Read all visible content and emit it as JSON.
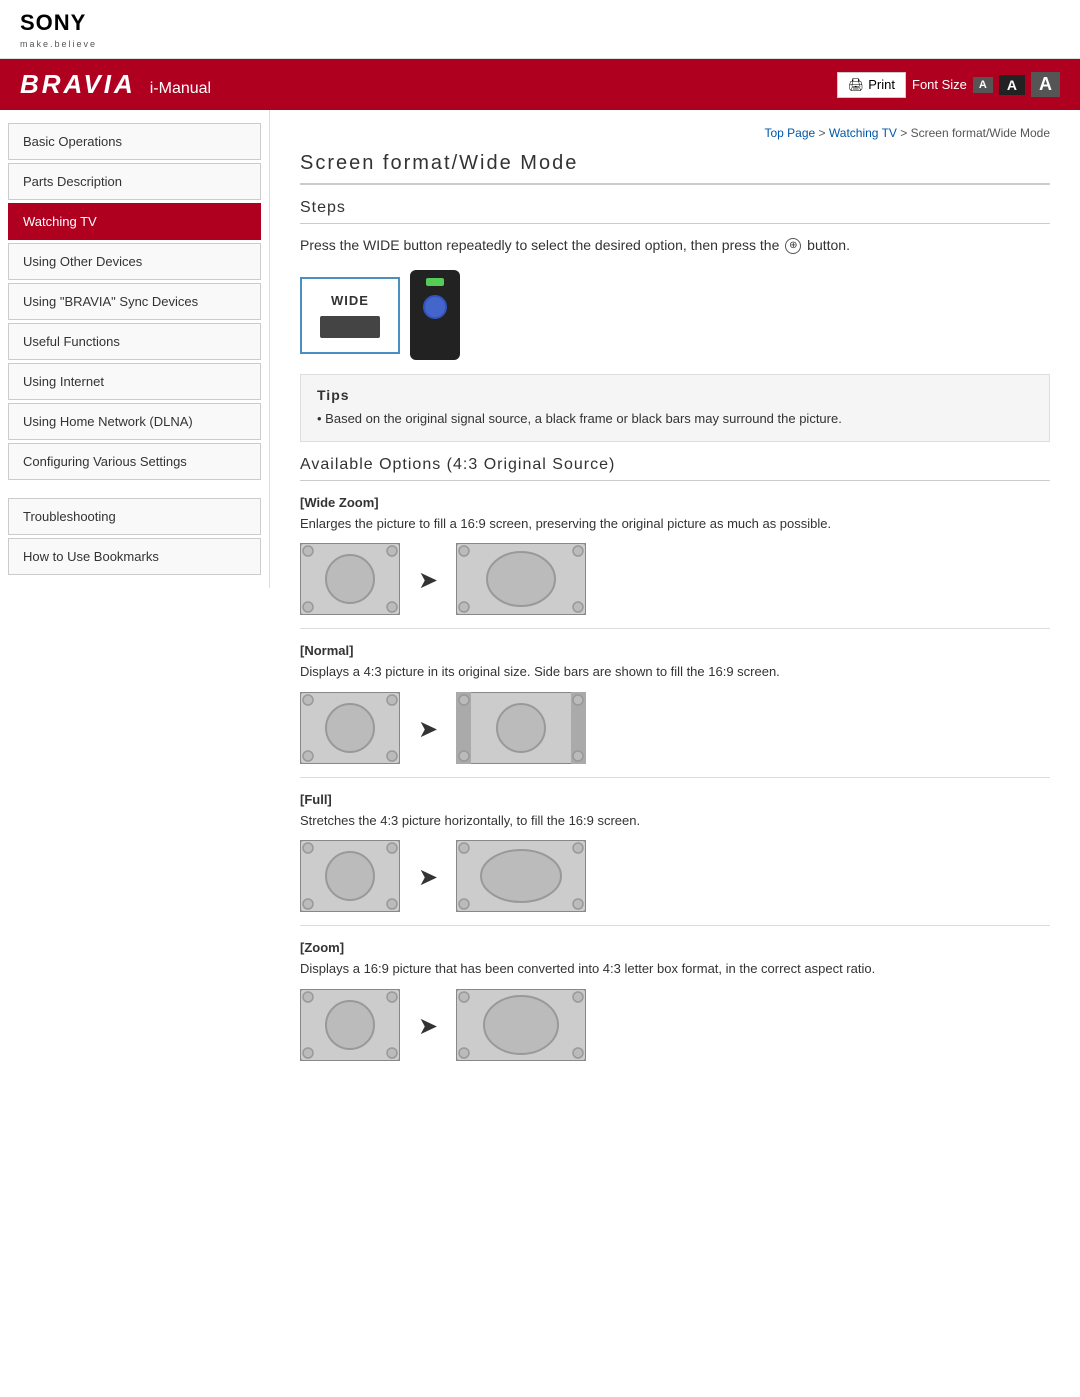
{
  "header": {
    "brand": "SONY",
    "tagline": "make.believe"
  },
  "navbar": {
    "bravia": "BRAVIA",
    "imanual": "i-Manual",
    "print_label": "Print",
    "font_size_label": "Font Size",
    "font_small": "A",
    "font_medium": "A",
    "font_large": "A"
  },
  "breadcrumb": {
    "top_page": "Top Page",
    "separator1": " > ",
    "watching_tv": "Watching TV",
    "separator2": " > ",
    "current": "Screen format/Wide Mode"
  },
  "sidebar": {
    "items": [
      {
        "id": "basic-operations",
        "label": "Basic Operations",
        "active": false
      },
      {
        "id": "parts-description",
        "label": "Parts Description",
        "active": false
      },
      {
        "id": "watching-tv",
        "label": "Watching TV",
        "active": true
      },
      {
        "id": "using-other-devices",
        "label": "Using Other Devices",
        "active": false
      },
      {
        "id": "using-bravia-sync",
        "label": "Using \"BRAVIA\" Sync Devices",
        "active": false
      },
      {
        "id": "useful-functions",
        "label": "Useful Functions",
        "active": false
      },
      {
        "id": "using-internet",
        "label": "Using Internet",
        "active": false
      },
      {
        "id": "using-home-network",
        "label": "Using Home Network (DLNA)",
        "active": false
      },
      {
        "id": "configuring-settings",
        "label": "Configuring Various Settings",
        "active": false
      },
      {
        "id": "troubleshooting",
        "label": "Troubleshooting",
        "active": false
      },
      {
        "id": "how-to-bookmarks",
        "label": "How to Use Bookmarks",
        "active": false
      }
    ]
  },
  "main": {
    "page_title": "Screen format/Wide Mode",
    "steps_heading": "Steps",
    "steps_text": "Press the WIDE button repeatedly to select the desired option, then press the",
    "steps_text_suffix": "button.",
    "wide_label": "WIDE",
    "tips": {
      "heading": "Tips",
      "item": "Based on the original signal source, a black frame or black bars may surround the picture."
    },
    "available_heading": "Available Options (4:3 Original Source)",
    "options": [
      {
        "id": "wide-zoom",
        "label": "[Wide Zoom]",
        "desc": "Enlarges the picture to fill a 16:9 screen, preserving the original picture as much as possible.",
        "from_type": "small",
        "to_type": "wide"
      },
      {
        "id": "normal",
        "label": "[Normal]",
        "desc": "Displays a 4:3 picture in its original size. Side bars are shown to fill the 16:9 screen.",
        "from_type": "small",
        "to_type": "sidebars"
      },
      {
        "id": "full",
        "label": "[Full]",
        "desc": "Stretches the 4:3 picture horizontally, to fill the 16:9 screen.",
        "from_type": "small",
        "to_type": "stretched"
      },
      {
        "id": "zoom",
        "label": "[Zoom]",
        "desc": "Displays a 16:9 picture that has been converted into 4:3 letter box format, in the correct aspect ratio.",
        "from_type": "small",
        "to_type": "zoom"
      }
    ]
  }
}
